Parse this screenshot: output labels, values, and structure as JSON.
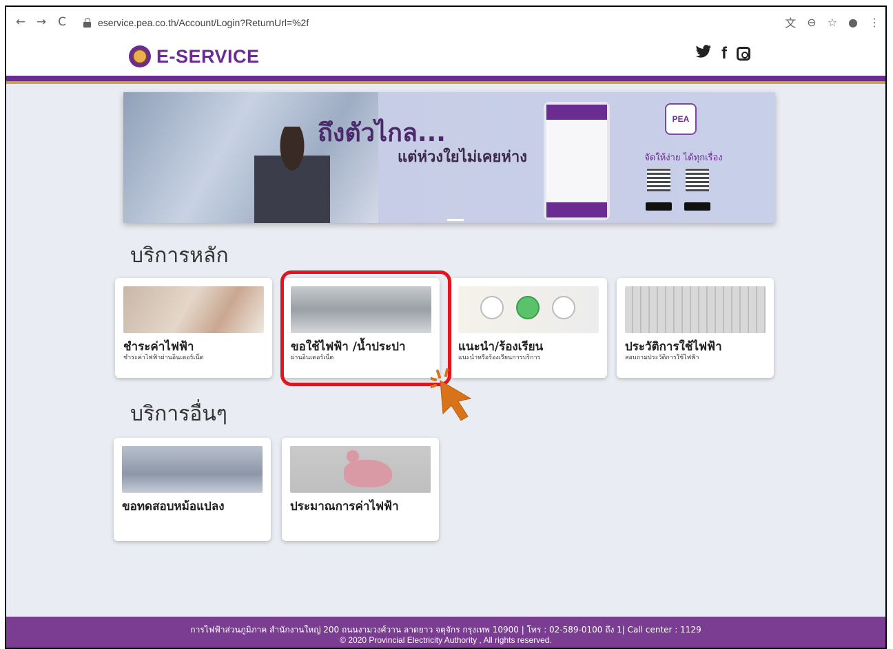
{
  "browser": {
    "url": "eservice.pea.co.th/Account/Login?ReturnUrl=%2f",
    "icons": [
      "back-icon",
      "forward-icon",
      "reload-icon",
      "lock-icon",
      "translate-icon",
      "zoom-icon",
      "star-icon",
      "profile-icon",
      "menu-icon"
    ]
  },
  "header": {
    "logo_text": "E-SERVICE",
    "social": [
      "twitter-icon",
      "facebook-icon",
      "instagram-icon"
    ],
    "twitter_glyph": "🐦",
    "facebook_glyph": "f"
  },
  "banner": {
    "headline": "ถึงตัวไกล...",
    "subline": "แต่ห่วงใยไม่เคยห่าง",
    "app_icon_text": "PEA",
    "tagline": "จัดให้ง่าย ได้ทุกเรื่อง"
  },
  "main_services": {
    "title": "บริการหลัก",
    "items": [
      {
        "title": "ชำระค่าไฟฟ้า",
        "subtitle": "ชำระค่าไฟฟ้าผ่านอินเตอร์เน็ต"
      },
      {
        "title": "ขอใช้ไฟฟ้า /น้ำประปา",
        "subtitle": "ผ่านอินเตอร์เน็ต"
      },
      {
        "title": "แนะนำ/ร้องเรียน",
        "subtitle": "แนะนำหรือร้องเรียนการบริการ"
      },
      {
        "title": "ประวัติการใช้ไฟฟ้า",
        "subtitle": "สอบถามประวัติการใช้ไฟฟ้า"
      }
    ]
  },
  "other_services": {
    "title": "บริการอื่นๆ",
    "items": [
      {
        "title": "ขอทดสอบหม้อแปลง"
      },
      {
        "title": "ประมาณการค่าไฟฟ้า"
      }
    ]
  },
  "footer": {
    "line1": "การไฟฟ้าส่วนภูมิภาค สำนักงานใหญ่ 200 ถนนงามวงศ์วาน ลาดยาว จตุจักร กรุงเทพ 10900  |  โทร : 02-589-0100 ถึง 1| Call center : 1129",
    "line2": "© 2020 Provincial Electricity Authority , All rights reserved."
  },
  "colors": {
    "brand_purple": "#6a2c91",
    "gold": "#c9a15a",
    "highlight_red": "#e3141d",
    "cursor_orange": "#d9731a"
  }
}
